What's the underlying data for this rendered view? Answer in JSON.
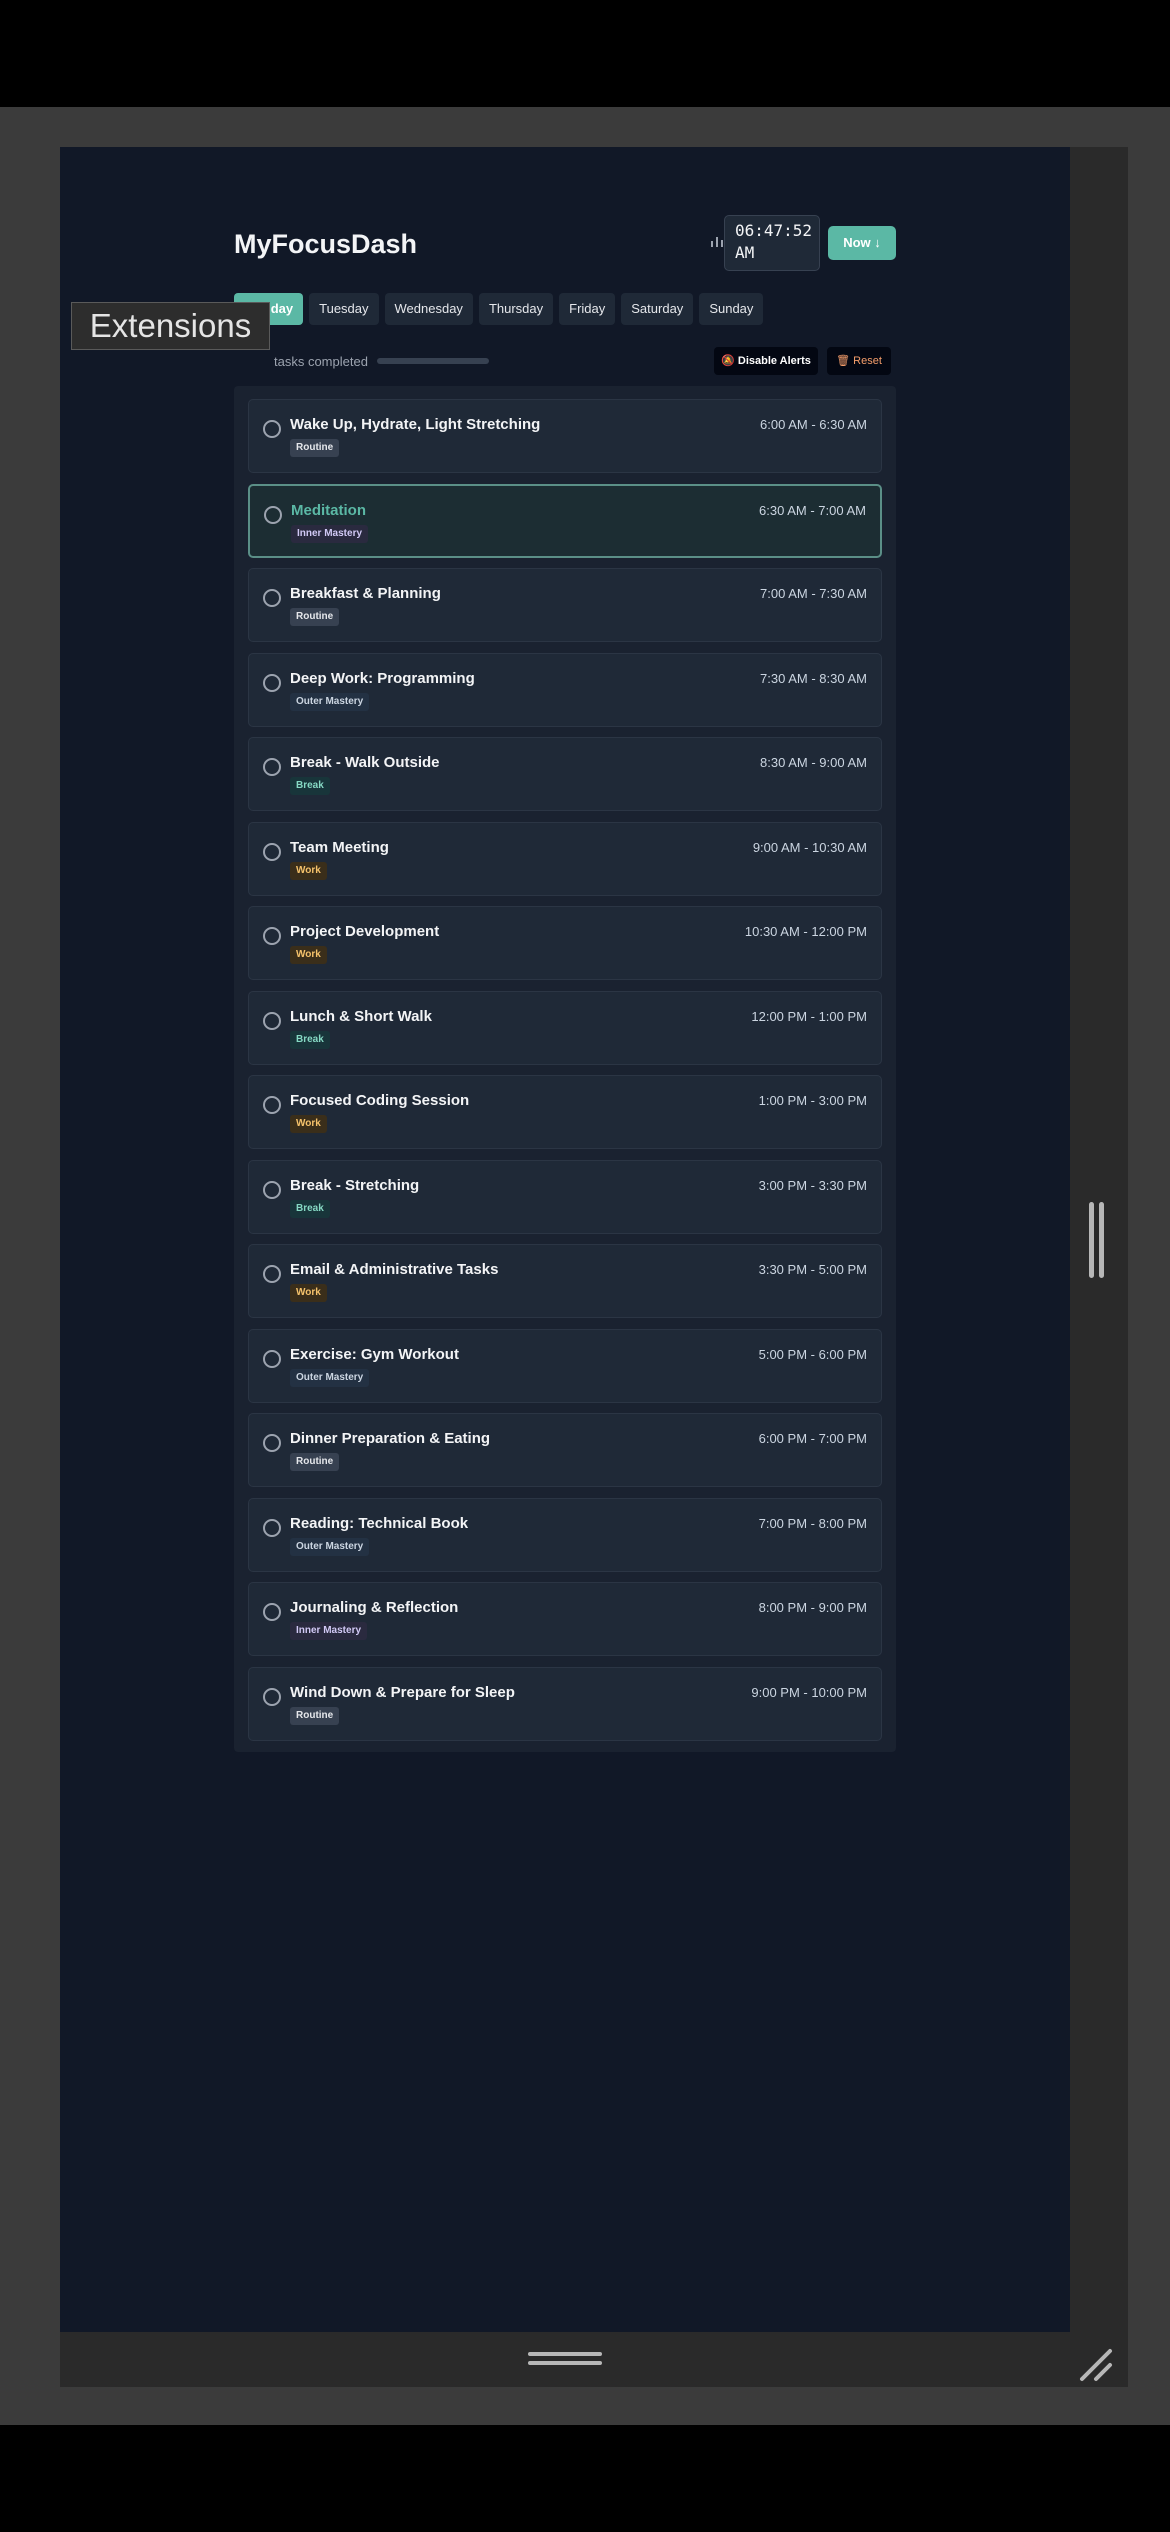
{
  "tooltip": {
    "text": "Extensions"
  },
  "header": {
    "title": "MyFocusDash",
    "stats_icon": "bar-chart-icon",
    "settings_icon": "gear-icon",
    "clock_time": "06:47:52",
    "clock_period": "AM",
    "now_button": "Now ↓"
  },
  "days": [
    "Monday",
    "Tuesday",
    "Wednesday",
    "Thursday",
    "Friday",
    "Saturday",
    "Sunday"
  ],
  "active_day": "Monday",
  "status": {
    "tasks_completed_text": "tasks completed",
    "progress_fraction": 0.0,
    "disable_alerts_label": "Disable Alerts",
    "reset_label": "Reset"
  },
  "tasks": [
    {
      "name": "Wake Up, Hydrate, Light Stretching",
      "time": "6:00 AM - 6:30 AM",
      "tag": "Routine",
      "tag_type": "routine",
      "current": false
    },
    {
      "name": "Meditation",
      "time": "6:30 AM - 7:00 AM",
      "tag": "Inner Mastery",
      "tag_type": "inner",
      "current": true
    },
    {
      "name": "Breakfast & Planning",
      "time": "7:00 AM - 7:30 AM",
      "tag": "Routine",
      "tag_type": "routine",
      "current": false
    },
    {
      "name": "Deep Work: Programming",
      "time": "7:30 AM - 8:30 AM",
      "tag": "Outer Mastery",
      "tag_type": "outer",
      "current": false
    },
    {
      "name": "Break - Walk Outside",
      "time": "8:30 AM - 9:00 AM",
      "tag": "Break",
      "tag_type": "break",
      "current": false
    },
    {
      "name": "Team Meeting",
      "time": "9:00 AM - 10:30 AM",
      "tag": "Work",
      "tag_type": "work",
      "current": false
    },
    {
      "name": "Project Development",
      "time": "10:30 AM - 12:00 PM",
      "tag": "Work",
      "tag_type": "work",
      "current": false
    },
    {
      "name": "Lunch & Short Walk",
      "time": "12:00 PM - 1:00 PM",
      "tag": "Break",
      "tag_type": "break",
      "current": false
    },
    {
      "name": "Focused Coding Session",
      "time": "1:00 PM - 3:00 PM",
      "tag": "Work",
      "tag_type": "work",
      "current": false
    },
    {
      "name": "Break - Stretching",
      "time": "3:00 PM - 3:30 PM",
      "tag": "Break",
      "tag_type": "break",
      "current": false
    },
    {
      "name": "Email & Administrative Tasks",
      "time": "3:30 PM - 5:00 PM",
      "tag": "Work",
      "tag_type": "work",
      "current": false
    },
    {
      "name": "Exercise: Gym Workout",
      "time": "5:00 PM - 6:00 PM",
      "tag": "Outer Mastery",
      "tag_type": "outer",
      "current": false
    },
    {
      "name": "Dinner Preparation & Eating",
      "time": "6:00 PM - 7:00 PM",
      "tag": "Routine",
      "tag_type": "routine",
      "current": false
    },
    {
      "name": "Reading: Technical Book",
      "time": "7:00 PM - 8:00 PM",
      "tag": "Outer Mastery",
      "tag_type": "outer",
      "current": false
    },
    {
      "name": "Journaling & Reflection",
      "time": "8:00 PM - 9:00 PM",
      "tag": "Inner Mastery",
      "tag_type": "inner",
      "current": false
    },
    {
      "name": "Wind Down & Prepare for Sleep",
      "time": "9:00 PM - 10:00 PM",
      "tag": "Routine",
      "tag_type": "routine",
      "current": false
    }
  ],
  "colors": {
    "accent": "#5bb8a5",
    "background": "#111827",
    "card": "#1f2937"
  }
}
